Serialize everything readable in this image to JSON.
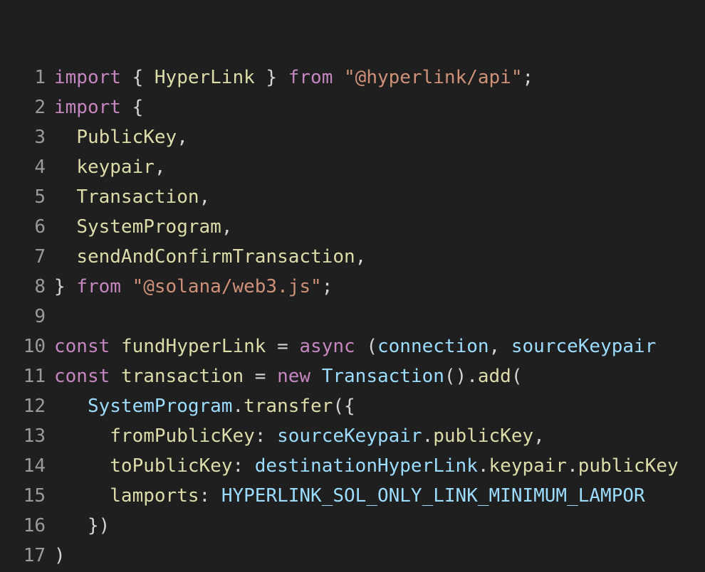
{
  "lines": [
    {
      "n": "1",
      "tokens": [
        {
          "t": "import",
          "c": "kw"
        },
        {
          "t": " { ",
          "c": "pn"
        },
        {
          "t": "HyperLink",
          "c": "id"
        },
        {
          "t": " } ",
          "c": "pn"
        },
        {
          "t": "from",
          "c": "kw"
        },
        {
          "t": " ",
          "c": "pn"
        },
        {
          "t": "\"@hyperlink/api\"",
          "c": "str"
        },
        {
          "t": ";",
          "c": "pn"
        }
      ]
    },
    {
      "n": "2",
      "tokens": [
        {
          "t": "import",
          "c": "kw"
        },
        {
          "t": " {",
          "c": "pn"
        }
      ]
    },
    {
      "n": "3",
      "tokens": [
        {
          "t": "  ",
          "c": "pn"
        },
        {
          "t": "PublicKey",
          "c": "id"
        },
        {
          "t": ",",
          "c": "pn"
        }
      ]
    },
    {
      "n": "4",
      "tokens": [
        {
          "t": "  ",
          "c": "pn"
        },
        {
          "t": "keypair",
          "c": "id"
        },
        {
          "t": ",",
          "c": "pn"
        }
      ]
    },
    {
      "n": "5",
      "tokens": [
        {
          "t": "  ",
          "c": "pn"
        },
        {
          "t": "Transaction",
          "c": "id"
        },
        {
          "t": ",",
          "c": "pn"
        }
      ]
    },
    {
      "n": "6",
      "tokens": [
        {
          "t": "  ",
          "c": "pn"
        },
        {
          "t": "SystemProgram",
          "c": "id"
        },
        {
          "t": ",",
          "c": "pn"
        }
      ]
    },
    {
      "n": "7",
      "tokens": [
        {
          "t": "  ",
          "c": "pn"
        },
        {
          "t": "sendAndConfirmTransaction",
          "c": "id"
        },
        {
          "t": ",",
          "c": "pn"
        }
      ]
    },
    {
      "n": "8",
      "tokens": [
        {
          "t": "} ",
          "c": "pn"
        },
        {
          "t": "from",
          "c": "kw"
        },
        {
          "t": " ",
          "c": "pn"
        },
        {
          "t": "\"@solana/web3.js\"",
          "c": "str"
        },
        {
          "t": ";",
          "c": "pn"
        }
      ]
    },
    {
      "n": "9",
      "tokens": []
    },
    {
      "n": "10",
      "tokens": [
        {
          "t": "const",
          "c": "kw"
        },
        {
          "t": " ",
          "c": "pn"
        },
        {
          "t": "fundHyperLink",
          "c": "id"
        },
        {
          "t": " = ",
          "c": "pn"
        },
        {
          "t": "async",
          "c": "kw"
        },
        {
          "t": " (",
          "c": "pn"
        },
        {
          "t": "connection",
          "c": "var"
        },
        {
          "t": ", ",
          "c": "pn"
        },
        {
          "t": "sourceKeypair",
          "c": "var"
        }
      ]
    },
    {
      "n": "11",
      "tokens": [
        {
          "t": "const",
          "c": "kw"
        },
        {
          "t": " ",
          "c": "pn"
        },
        {
          "t": "transaction",
          "c": "id"
        },
        {
          "t": " = ",
          "c": "pn"
        },
        {
          "t": "new",
          "c": "kw"
        },
        {
          "t": " ",
          "c": "pn"
        },
        {
          "t": "Transaction",
          "c": "var"
        },
        {
          "t": "().",
          "c": "pn"
        },
        {
          "t": "add",
          "c": "fn"
        },
        {
          "t": "(",
          "c": "pn"
        }
      ]
    },
    {
      "n": "12",
      "tokens": [
        {
          "t": "   ",
          "c": "pn"
        },
        {
          "t": "SystemProgram",
          "c": "var"
        },
        {
          "t": ".",
          "c": "pn"
        },
        {
          "t": "transfer",
          "c": "fn"
        },
        {
          "t": "({",
          "c": "pn"
        }
      ]
    },
    {
      "n": "13",
      "tokens": [
        {
          "t": "     ",
          "c": "pn"
        },
        {
          "t": "fromPublicKey",
          "c": "id"
        },
        {
          "t": ": ",
          "c": "pn"
        },
        {
          "t": "sourceKeypair",
          "c": "var"
        },
        {
          "t": ".",
          "c": "pn"
        },
        {
          "t": "publicKey",
          "c": "id"
        },
        {
          "t": ",",
          "c": "pn"
        }
      ]
    },
    {
      "n": "14",
      "tokens": [
        {
          "t": "     ",
          "c": "pn"
        },
        {
          "t": "toPublicKey",
          "c": "id"
        },
        {
          "t": ": ",
          "c": "pn"
        },
        {
          "t": "destinationHyperLink",
          "c": "var"
        },
        {
          "t": ".",
          "c": "pn"
        },
        {
          "t": "keypair",
          "c": "id"
        },
        {
          "t": ".",
          "c": "pn"
        },
        {
          "t": "publicKey",
          "c": "id"
        }
      ]
    },
    {
      "n": "15",
      "tokens": [
        {
          "t": "     ",
          "c": "pn"
        },
        {
          "t": "lamports",
          "c": "id"
        },
        {
          "t": ": ",
          "c": "pn"
        },
        {
          "t": "HYPERLINK_SOL_ONLY_LINK_MINIMUM_LAMPOR",
          "c": "var"
        }
      ]
    },
    {
      "n": "16",
      "tokens": [
        {
          "t": "   })",
          "c": "pn"
        }
      ]
    },
    {
      "n": "17",
      "tokens": [
        {
          "t": ")",
          "c": "pn"
        }
      ]
    }
  ]
}
